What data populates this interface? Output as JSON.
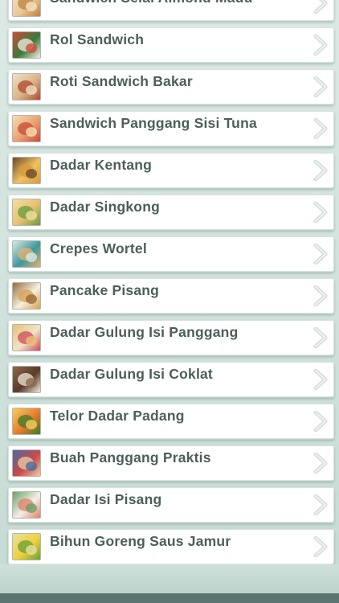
{
  "recipes": [
    {
      "label": "Sandwich Selai Almond Madu",
      "icon": "sandwich-photo",
      "colors": [
        "#e8c89a",
        "#c0803c",
        "#f4e4c4"
      ]
    },
    {
      "label": "Rol Sandwich",
      "icon": "sushi-roll-photo",
      "colors": [
        "#3a7a3a",
        "#f2efe6",
        "#d24a3a"
      ]
    },
    {
      "label": "Roti Sandwich Bakar",
      "icon": "toasted-sandwich-photo",
      "colors": [
        "#d8b48a",
        "#b04a2a",
        "#f0e0c8"
      ]
    },
    {
      "label": "Sandwich Panggang Sisi Tuna",
      "icon": "grilled-sandwich-photo",
      "colors": [
        "#e8a070",
        "#c84a3a",
        "#f6e0b0"
      ]
    },
    {
      "label": "Dadar Kentang",
      "icon": "potato-omelette-photo",
      "colors": [
        "#f0c060",
        "#d89a3a",
        "#6a4a2a"
      ]
    },
    {
      "label": "Dadar Singkong",
      "icon": "cassava-omelette-photo",
      "colors": [
        "#e6c070",
        "#6a9a3a",
        "#f2e0a0"
      ]
    },
    {
      "label": "Crepes Wortel",
      "icon": "carrot-crepes-photo",
      "colors": [
        "#3a9a9a",
        "#e8b070",
        "#d8e8e8"
      ]
    },
    {
      "label": "Pancake Pisang",
      "icon": "banana-pancake-photo",
      "colors": [
        "#f4f0e0",
        "#d8a050",
        "#9a6a3a"
      ]
    },
    {
      "label": "Dadar Gulung Isi Panggang",
      "icon": "rolled-omelette-photo",
      "colors": [
        "#f0e4c8",
        "#d04a5a",
        "#e8c070"
      ]
    },
    {
      "label": "Dadar Gulung Isi Coklat",
      "icon": "chocolate-roll-photo",
      "colors": [
        "#5a3a2a",
        "#f0e8d8",
        "#8a6a4a"
      ]
    },
    {
      "label": "Telor Dadar Padang",
      "icon": "padang-omelette-photo",
      "colors": [
        "#e87a2a",
        "#3a7a2a",
        "#f4d060"
      ]
    },
    {
      "label": "Buah Panggang Praktis",
      "icon": "baked-fruit-photo",
      "colors": [
        "#c84a4a",
        "#e8d0a0",
        "#4a6aa0"
      ]
    },
    {
      "label": "Dadar Isi Pisang",
      "icon": "banana-omelette-photo",
      "colors": [
        "#f4f0e8",
        "#e08060",
        "#6aa06a"
      ]
    },
    {
      "label": "Bihun Goreng Saus Jamur",
      "icon": "fried-vermicelli-photo",
      "colors": [
        "#f0d040",
        "#6aa030",
        "#e8e0a0"
      ]
    }
  ]
}
